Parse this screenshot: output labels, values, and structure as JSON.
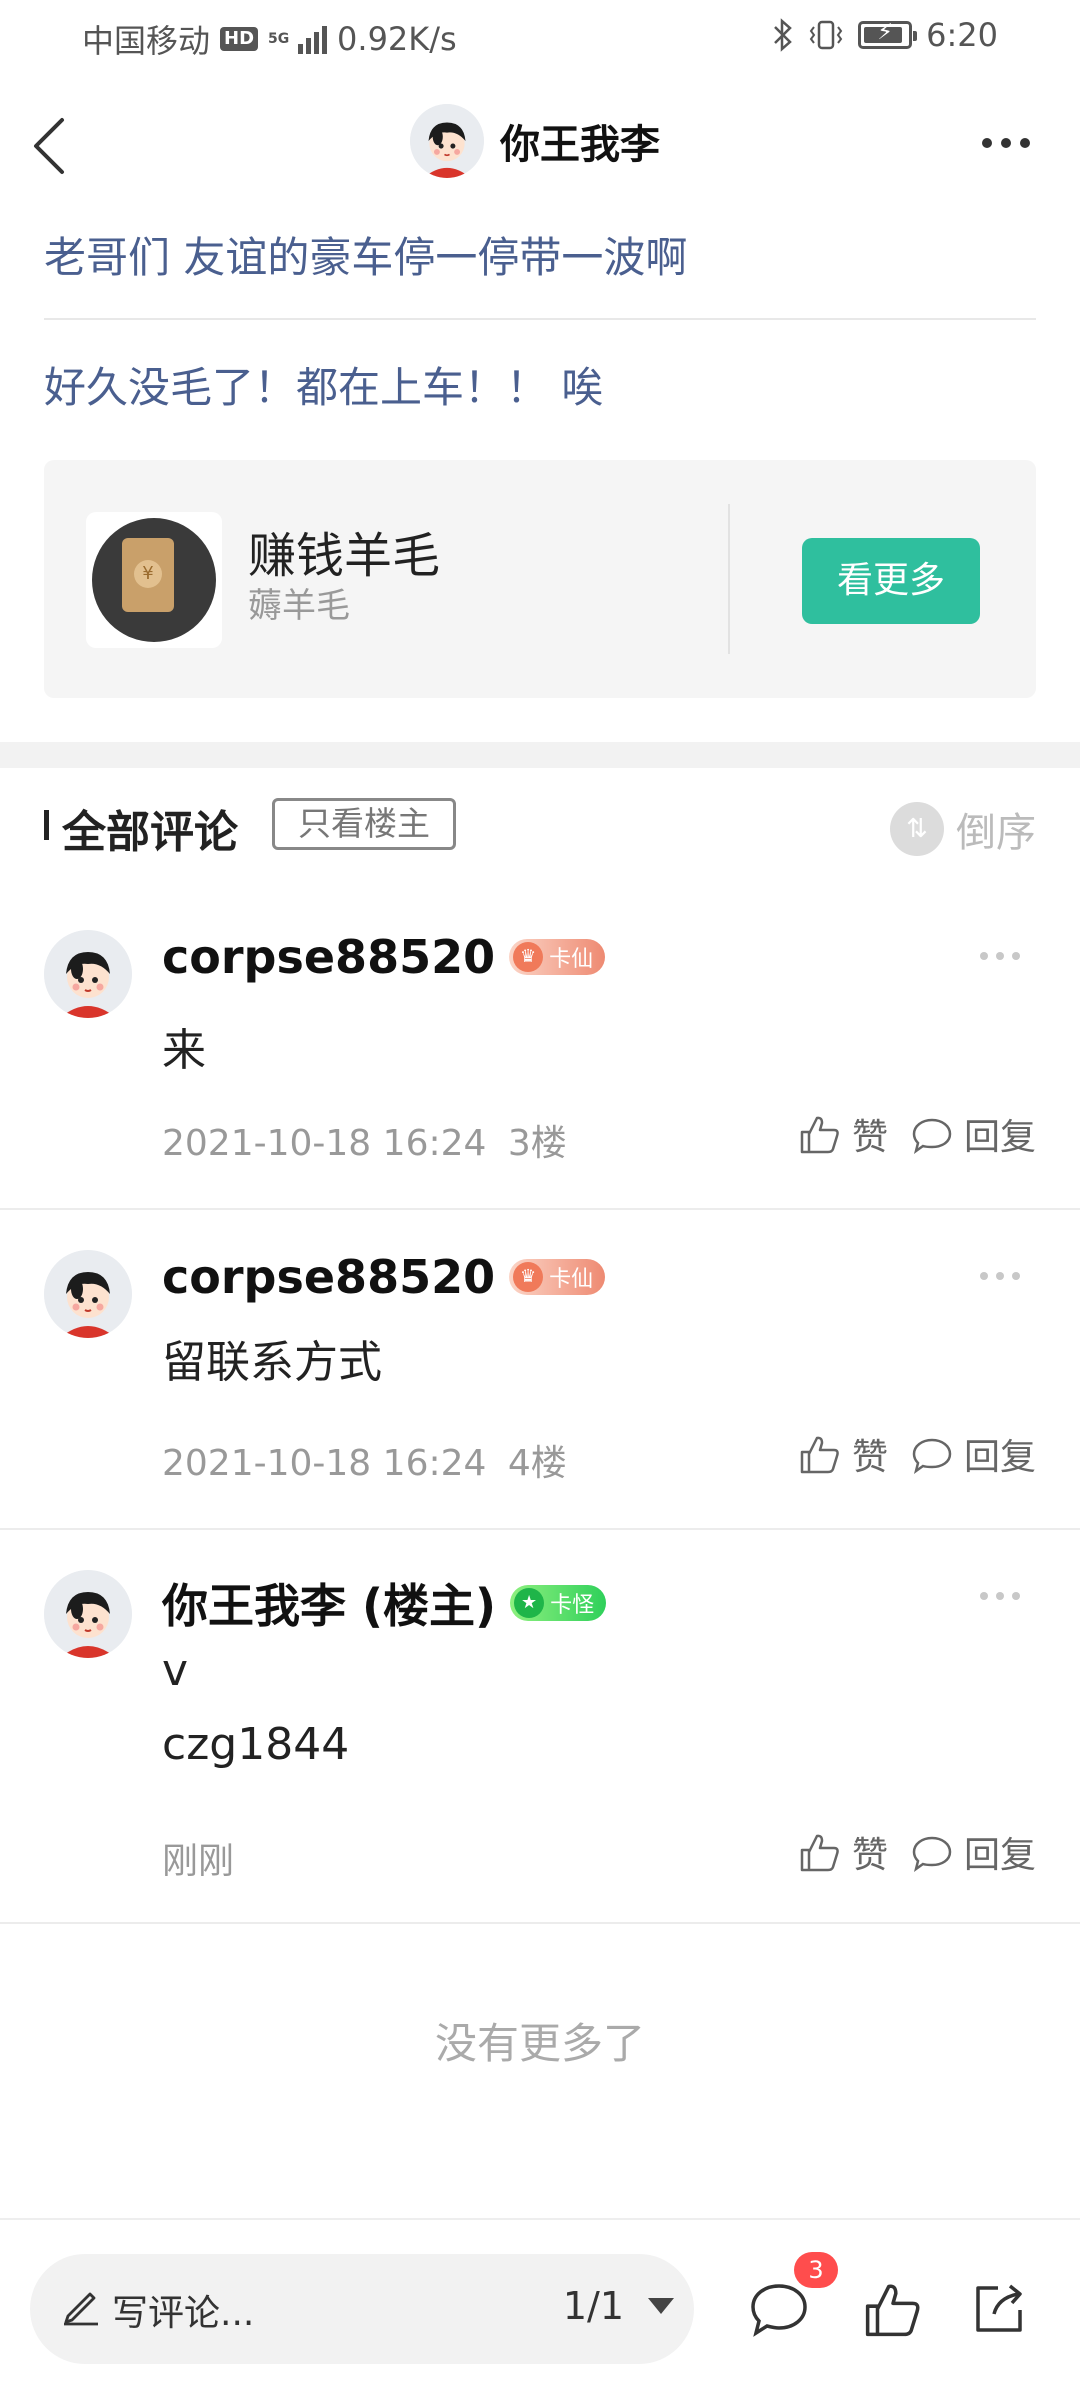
{
  "status_bar": {
    "carrier": "中国移动",
    "hd": "HD",
    "network": "5G",
    "speed": "0.92K/s",
    "time": "6:20"
  },
  "nav": {
    "title": "你王我李"
  },
  "post": {
    "title": "老哥们 友谊的豪车停一停带一波啊",
    "body": "好久没毛了！都在上车！！ 唉"
  },
  "card": {
    "name": "赚钱羊毛",
    "subtitle": "薅羊毛",
    "coin_symbol": "¥",
    "button_label": "看更多"
  },
  "comments_header": {
    "title": "全部评论",
    "op_only_label": "只看楼主",
    "sort_label": "倒序"
  },
  "comments": [
    {
      "author": "corpse88520",
      "badge": "卡仙",
      "lines": [
        "来"
      ],
      "time": "2021-10-18 16:24",
      "floor": "3楼",
      "like_label": "赞",
      "reply_label": "回复"
    },
    {
      "author": "corpse88520",
      "badge": "卡仙",
      "lines": [
        "留联系方式"
      ],
      "time": "2021-10-18 16:24",
      "floor": "4楼",
      "like_label": "赞",
      "reply_label": "回复"
    },
    {
      "author": "你王我李 (楼主)",
      "badge": "卡怪",
      "lines": [
        "v",
        "czg1844"
      ],
      "time": "刚刚",
      "floor": "",
      "like_label": "赞",
      "reply_label": "回复"
    }
  ],
  "no_more_text": "没有更多了",
  "bottom_bar": {
    "comment_placeholder": "写评论...",
    "page_indicator": "1/1",
    "comment_count_badge": "3"
  },
  "colors": {
    "accent": "#2fbf9e",
    "post_text": "#4a5f8f",
    "badge_red": "#ff4d4d"
  },
  "icons": [
    "back-icon",
    "more-icon",
    "sort-icon",
    "like-icon",
    "reply-icon",
    "pen-icon",
    "comment-icon",
    "share-icon"
  ]
}
